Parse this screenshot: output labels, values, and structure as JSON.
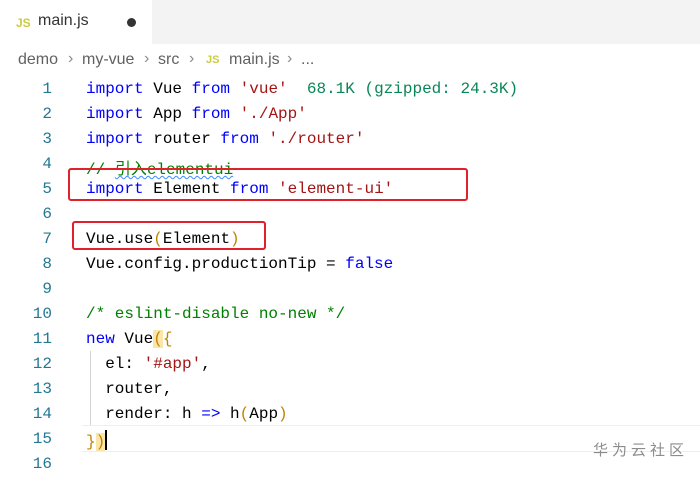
{
  "tab": {
    "icon": "JS",
    "title": "main.js",
    "dirty": true
  },
  "breadcrumb": [
    "demo",
    "my-vue",
    "src",
    "main.js",
    "..."
  ],
  "breadcrumb_file_icon": "JS",
  "line_numbers": [
    "1",
    "2",
    "3",
    "4",
    "5",
    "6",
    "7",
    "8",
    "9",
    "10",
    "11",
    "12",
    "13",
    "14",
    "15",
    "16"
  ],
  "code": {
    "l1_kw": "import",
    "l1_a": " Vue ",
    "l1_from": "from",
    "l1_str": "'vue'",
    "l1_lens": "68.1K (gzipped: 24.3K)",
    "l2_kw": "import",
    "l2_a": " App ",
    "l2_from": "from",
    "l2_str": "'./App'",
    "l3_kw": "import",
    "l3_a": " router ",
    "l3_from": "from",
    "l3_str": "'./router'",
    "l4_cmt_a": "// ",
    "l4_cmt_b": "引入elementui",
    "l5_kw": "import",
    "l5_a": " Element ",
    "l5_from": "from",
    "l5_str": "'element-ui'",
    "l7_a": "Vue.use",
    "l7_open": "(",
    "l7_b": "Element",
    "l7_close": ")",
    "l8_a": "Vue.config.productionTip = ",
    "l8_kw": "false",
    "l10_cmt": "/* eslint-disable no-new */",
    "l11_kw": "new",
    "l11_a": " Vue",
    "l11_paren": "(",
    "l11_brace": "{",
    "l12_a": "el: ",
    "l12_str": "'#app'",
    "l12_b": ",",
    "l13_a": "router,",
    "l14_a": "render: h ",
    "l14_arrow": "=>",
    "l14_b": " h",
    "l14_open": "(",
    "l14_c": "App",
    "l14_close": ")",
    "l15_brace": "}",
    "l15_paren": ")"
  },
  "watermark": "华为云社区",
  "colors": {
    "keyword": "#0000ff",
    "string": "#a31515",
    "comment": "#008000",
    "highlight_box": "#e0202a"
  }
}
